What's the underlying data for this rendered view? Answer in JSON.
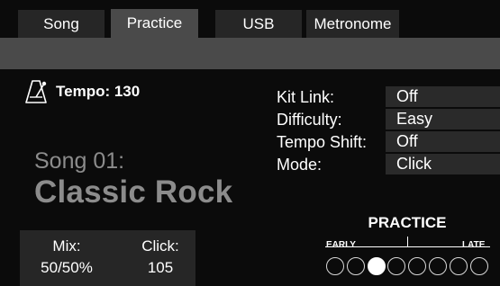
{
  "tabs": [
    {
      "label": "Song"
    },
    {
      "label": "Practice"
    },
    {
      "label": "USB"
    },
    {
      "label": "Metronome"
    }
  ],
  "tempo": {
    "text": "Tempo: 130",
    "icon": "metronome-icon"
  },
  "song": {
    "number": "Song 01:",
    "name": "Classic Rock"
  },
  "settings": [
    {
      "label": "Kit Link:",
      "value": "Off"
    },
    {
      "label": "Difficulty:",
      "value": "Easy"
    },
    {
      "label": "Tempo Shift:",
      "value": "Off"
    },
    {
      "label": "Mode:",
      "value": "Click"
    }
  ],
  "mix": {
    "mix_label": "Mix:",
    "mix_value": "50/50%",
    "click_label": "Click:",
    "click_value": "105"
  },
  "practice_meter": {
    "title": "PRACTICE",
    "early_label": "EARLY",
    "late_label": "LATE",
    "dot_count": 8,
    "active_dot_index": 2
  },
  "colors": {
    "background": "#0b0b0b",
    "tab_active": "#4a4a4a",
    "tab_inactive": "#262626",
    "value_box": "#2a2a2a",
    "song_text": "#8c8c8c"
  }
}
